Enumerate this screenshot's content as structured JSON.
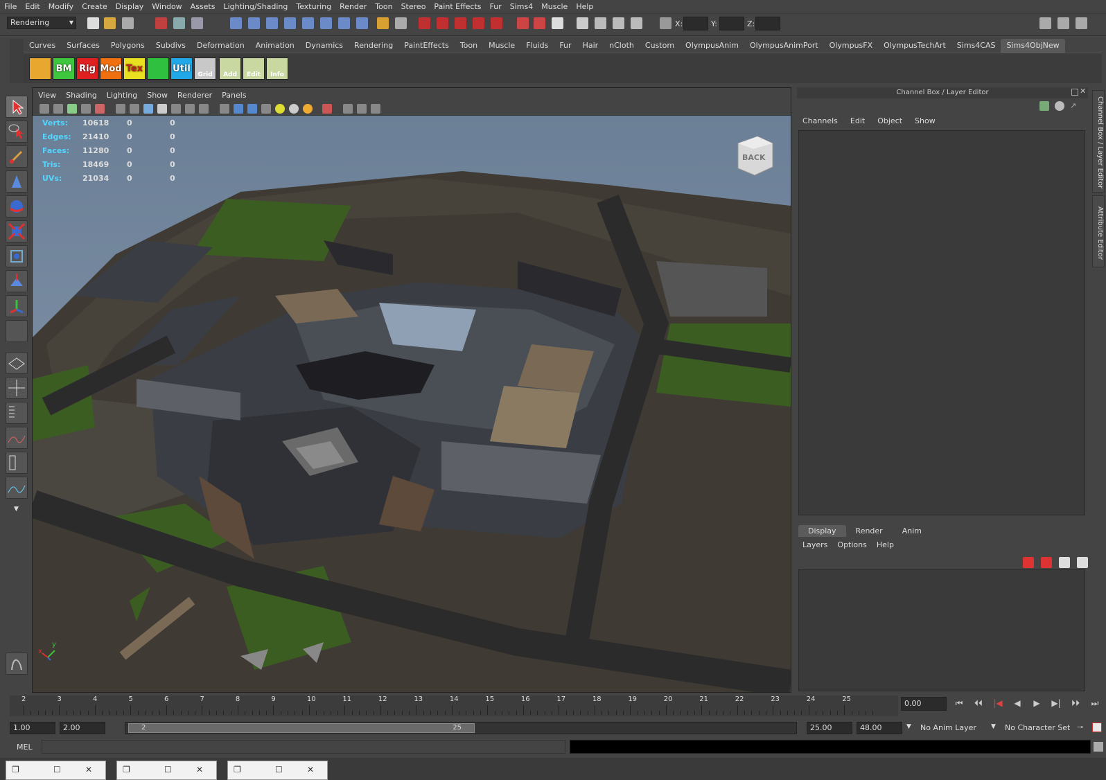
{
  "menubar": {
    "items": [
      "File",
      "Edit",
      "Modify",
      "Create",
      "Display",
      "Window",
      "Assets",
      "Lighting/Shading",
      "Texturing",
      "Render",
      "Toon",
      "Stereo",
      "Paint Effects",
      "Fur",
      "Sims4",
      "Muscle",
      "Help"
    ]
  },
  "status": {
    "mode": "Rendering",
    "x_label": "X:",
    "y_label": "Y:",
    "z_label": "Z:"
  },
  "shelf": {
    "tabs": [
      "Curves",
      "Surfaces",
      "Polygons",
      "Subdivs",
      "Deformation",
      "Animation",
      "Dynamics",
      "Rendering",
      "PaintEffects",
      "Toon",
      "Muscle",
      "Fluids",
      "Fur",
      "Hair",
      "nCloth",
      "Custom",
      "OlympusAnim",
      "OlympusAnimPort",
      "OlympusFX",
      "OlympusTechArt",
      "Sims4CAS",
      "Sims4ObjNew"
    ],
    "active_tab": "Sims4ObjNew",
    "buttons": [
      {
        "label": "",
        "color": "#e8a830"
      },
      {
        "label": "BM",
        "color": "#3ec63e"
      },
      {
        "label": "Rig",
        "color": "#e02020"
      },
      {
        "label": "Mod",
        "color": "#f07010"
      },
      {
        "label": "Tex",
        "color": "#e8e020"
      },
      {
        "label": "",
        "color": "#30c040"
      },
      {
        "label": "Util",
        "color": "#20a8e8"
      },
      {
        "label": "Grid",
        "color": "#c8c8c8"
      },
      {
        "label": "Add",
        "color": "#c8d8a0"
      },
      {
        "label": "Edit",
        "color": "#c8d8a0"
      },
      {
        "label": "Info",
        "color": "#c8d8a0"
      }
    ]
  },
  "viewport": {
    "menu": [
      "View",
      "Shading",
      "Lighting",
      "Show",
      "Renderer",
      "Panels"
    ],
    "hud": [
      {
        "label": "Verts:",
        "v1": "10618",
        "v2": "0",
        "v3": "0"
      },
      {
        "label": "Edges:",
        "v1": "21410",
        "v2": "0",
        "v3": "0"
      },
      {
        "label": "Faces:",
        "v1": "11280",
        "v2": "0",
        "v3": "0"
      },
      {
        "label": "Tris:",
        "v1": "18469",
        "v2": "0",
        "v3": "0"
      },
      {
        "label": "UVs:",
        "v1": "21034",
        "v2": "0",
        "v3": "0"
      }
    ],
    "viewcube_label": "BACK",
    "axis_x": "x",
    "axis_y": "y"
  },
  "channelbox": {
    "title": "Channel Box / Layer Editor",
    "menu": [
      "Channels",
      "Edit",
      "Object",
      "Show"
    ],
    "side_tabs": [
      "Channel Box / Layer Editor",
      "Attribute Editor"
    ]
  },
  "layers": {
    "tabs": [
      "Display",
      "Render",
      "Anim"
    ],
    "active_tab": "Display",
    "menu": [
      "Layers",
      "Options",
      "Help"
    ]
  },
  "timeline": {
    "ticks": [
      "2",
      "3",
      "4",
      "5",
      "6",
      "7",
      "8",
      "9",
      "10",
      "11",
      "12",
      "13",
      "14",
      "15",
      "16",
      "17",
      "18",
      "19",
      "20",
      "21",
      "22",
      "23",
      "24",
      "25"
    ],
    "current_time": "0.00"
  },
  "range": {
    "start": "1.00",
    "playback_start": "2.00",
    "slider_start": "2",
    "slider_end": "25",
    "playback_end": "25.00",
    "end": "48.00",
    "anim_layer": "No Anim Layer",
    "character_set": "No Character Set"
  },
  "cmdline": {
    "label": "MEL"
  }
}
